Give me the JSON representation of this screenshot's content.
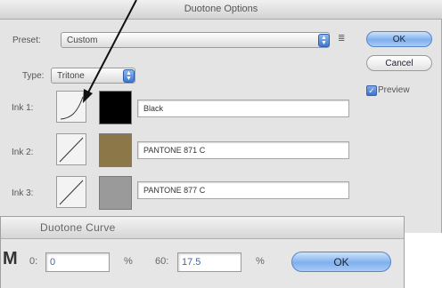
{
  "dialog": {
    "title": "Duotone Options",
    "preset_label": "Preset:",
    "preset_value": "Custom",
    "type_label": "Type:",
    "type_value": "Tritone",
    "ok_label": "OK",
    "cancel_label": "Cancel",
    "preview_label": "Preview",
    "preview_checked": true,
    "inks": [
      {
        "label": "Ink 1:",
        "name": "Black",
        "color": "#000000"
      },
      {
        "label": "Ink 2:",
        "name": "PANTONE 871 C",
        "color": "#8c7748"
      },
      {
        "label": "Ink 3:",
        "name": "PANTONE 877 C",
        "color": "#9a9a9a"
      }
    ]
  },
  "curve_dialog": {
    "title": "Duotone Curve",
    "fields": [
      {
        "label": "0:",
        "value": "0",
        "unit": "%"
      },
      {
        "label": "60:",
        "value": "17.5",
        "unit": "%"
      }
    ],
    "ok_label": "OK"
  }
}
